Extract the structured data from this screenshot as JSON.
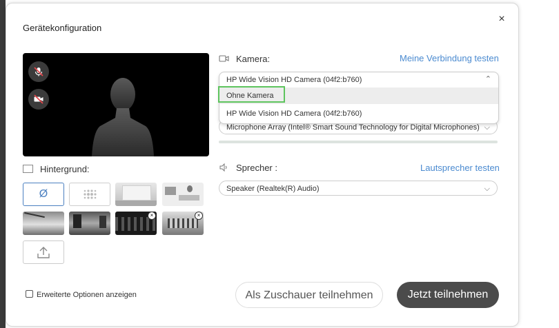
{
  "dialog": {
    "title": "Gerätekonfiguration",
    "close_glyph": "×"
  },
  "preview": {
    "mic_icon": "mic-muted-icon",
    "camera_icon": "camera-off-icon"
  },
  "background": {
    "label": "Hintergrund:",
    "none_glyph": "Ø",
    "tiles": [
      "none",
      "blur",
      "room",
      "office-desk",
      "beach",
      "city-waterfront",
      "business-people",
      "office-lobby",
      "upload"
    ]
  },
  "camera": {
    "label": "Kamera:",
    "test_link": "Meine Verbindung testen",
    "selected": "HP Wide Vision HD Camera (04f2:b760)",
    "options": [
      "Ohne Kamera",
      "HP Wide Vision HD Camera (04f2:b760)"
    ]
  },
  "microphone": {
    "selected": "Microphone Array (Intel® Smart Sound Technology for Digital Microphones)"
  },
  "speaker": {
    "label": "Sprecher :",
    "test_link": "Lautsprecher testen",
    "selected": "Speaker (Realtek(R) Audio)"
  },
  "advanced": {
    "label": "Erweiterte Optionen anzeigen"
  },
  "actions": {
    "viewer_button": "Als Zuschauer teilnehmen",
    "join_button": "Jetzt teilnehmen"
  },
  "colors": {
    "accent": "#4a8ad0",
    "highlight": "#5dc45d",
    "primary_button": "#4b4b4b"
  }
}
